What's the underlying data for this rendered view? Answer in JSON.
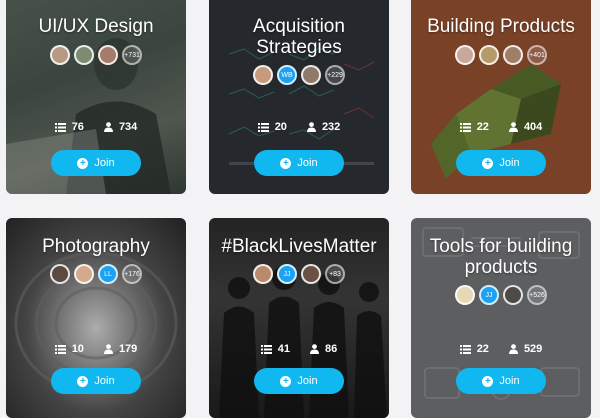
{
  "cards": [
    {
      "title": "UI/UX Design",
      "avatars": [
        "",
        "",
        ""
      ],
      "more": "+731",
      "lists": "76",
      "members": "734",
      "join_label": "Join"
    },
    {
      "title": "Acquisition Strategies",
      "avatars": [
        "",
        "WB",
        ""
      ],
      "more": "+229",
      "lists": "20",
      "members": "232",
      "join_label": "Join"
    },
    {
      "title": "Building Products",
      "avatars": [
        "",
        "",
        ""
      ],
      "more": "+401",
      "lists": "22",
      "members": "404",
      "join_label": "Join"
    },
    {
      "title": "Photography",
      "avatars": [
        "",
        "",
        "LL"
      ],
      "more": "+176",
      "lists": "10",
      "members": "179",
      "join_label": "Join"
    },
    {
      "title": "#BlackLivesMatter",
      "avatars": [
        "",
        "JJ",
        ""
      ],
      "more": "+83",
      "lists": "41",
      "members": "86",
      "join_label": "Join"
    },
    {
      "title": "Tools for building products",
      "avatars": [
        "",
        "JJ",
        ""
      ],
      "more": "+526",
      "lists": "22",
      "members": "529",
      "join_label": "Join"
    }
  ],
  "colors": {
    "join_button": "#11b8f0",
    "page_background": "#f3f3f5"
  },
  "icons": {
    "lists": "list-icon",
    "members": "person-icon",
    "join": "plus-circle-icon"
  }
}
